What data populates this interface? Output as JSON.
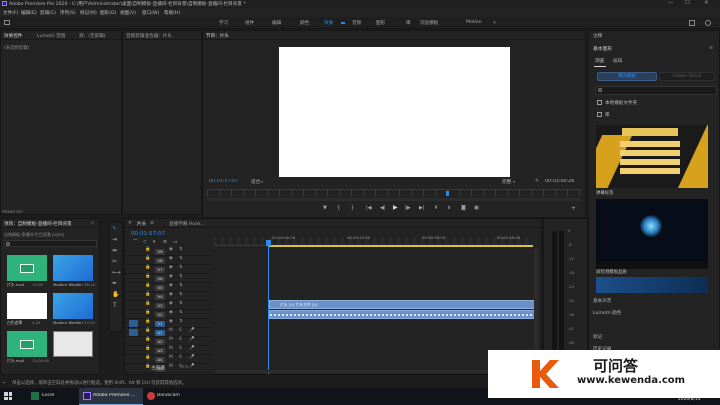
{
  "window": {
    "title": "Adobe Premiere Pro 2020 - C:\\用户\\Administrator\\桌面\\自制模板-直播间-栏目背景\\自制模板-直播间-栏目背景 *",
    "min": "—",
    "max": "☐",
    "close": "✕"
  },
  "menu": [
    "文件(F)",
    "编辑(E)",
    "剪辑(C)",
    "序列(S)",
    "标记(M)",
    "图形(G)",
    "视图(V)",
    "窗口(W)",
    "帮助(H)"
  ],
  "workspaces": [
    "学习",
    "组件",
    "编辑",
    "颜色",
    "效果",
    "音频",
    "图形",
    "库",
    "",
    "浏览模板",
    "Motion"
  ],
  "left_top": {
    "tabs": [
      "效果控件",
      "Lumetri 范围",
      "源：(无剪辑)"
    ],
    "no_clip": "(未选择剪辑)"
  },
  "audio_mixer": {
    "tab": "音频剪辑混合器：片头"
  },
  "program": {
    "tab": "节目：片头",
    "timecode": "00:01:57:07",
    "fit": "适合",
    "quality": "完整",
    "duration": "00:03:00:26"
  },
  "left_bottom_label": "Mixed ILP",
  "project": {
    "tabs": [
      "项目：自制模板-直播间-栏目背景",
      "媒体浏览器"
    ],
    "path": "自制模板-直播间-栏目背景.prproj",
    "items": [
      {
        "name": "片头.mp4",
        "dur": "15:09"
      },
      {
        "name": "Modern Wedding Slid...",
        "dur": "36:14"
      },
      {
        "name": "白色遮罩",
        "dur": "4:25"
      },
      {
        "name": "Modern Wedding Slid...",
        "dur": "33:15"
      },
      {
        "name": "片头.mp4",
        "dur": "15:00:00"
      },
      {
        "name": "",
        "dur": ""
      }
    ]
  },
  "timeline": {
    "tabs": [
      "片头",
      "直播字幕 Hook..."
    ],
    "timecode": "00:01:57:07",
    "ruler": [
      "00:00:00:00",
      "00:00:15:00",
      "00:00:30:00",
      "00:00:45:00"
    ],
    "tracks": [
      "V9",
      "V8",
      "V7",
      "V6",
      "V5",
      "V4",
      "V3",
      "V2",
      "V1",
      "A1",
      "A2",
      "A3",
      "A4",
      "A5"
    ],
    "clip_label": "片头 [V] 片头文件 [V]",
    "master": "主声道",
    "master_val": "0.0"
  },
  "meter_scale": [
    "0",
    "-6",
    "-12",
    "-18",
    "-24",
    "-30",
    "-36",
    "-42",
    "-48",
    "-54"
  ],
  "essential": {
    "panel_title": "基本图形",
    "tabs": [
      "浏览",
      "编辑"
    ],
    "my_templates": "我的模板",
    "local_templates": "Adobe Stock",
    "search_placeholder": "",
    "check_local": "本地模板文件夹",
    "check_all": "库",
    "thumb1_title": "弹幕标签",
    "thumb2_title": "",
    "thumb3_title": "再检测模板品质",
    "audio_title": "基本声音",
    "audio_sub": "Lumetri 颜色",
    "marker": "标记",
    "history": "历史记录"
  },
  "statusbar": "单击以选择，或单击空白处并拖动以进行框选。使用 Shift、Alt 和 Ctrl 可获得其他选项。",
  "taskbar": {
    "apps": [
      "Excel",
      "Adobe Premiere ...",
      "Bandicam"
    ],
    "time": "21:00",
    "date": "2020/8/14"
  },
  "watermark": {
    "brand": "可问答",
    "url": "www.kewenda.com"
  },
  "colors": {
    "accent": "#2d8ceb",
    "clip_blue": "#6a90c8",
    "panel": "#232323",
    "green_clip": "#2fb37d"
  }
}
